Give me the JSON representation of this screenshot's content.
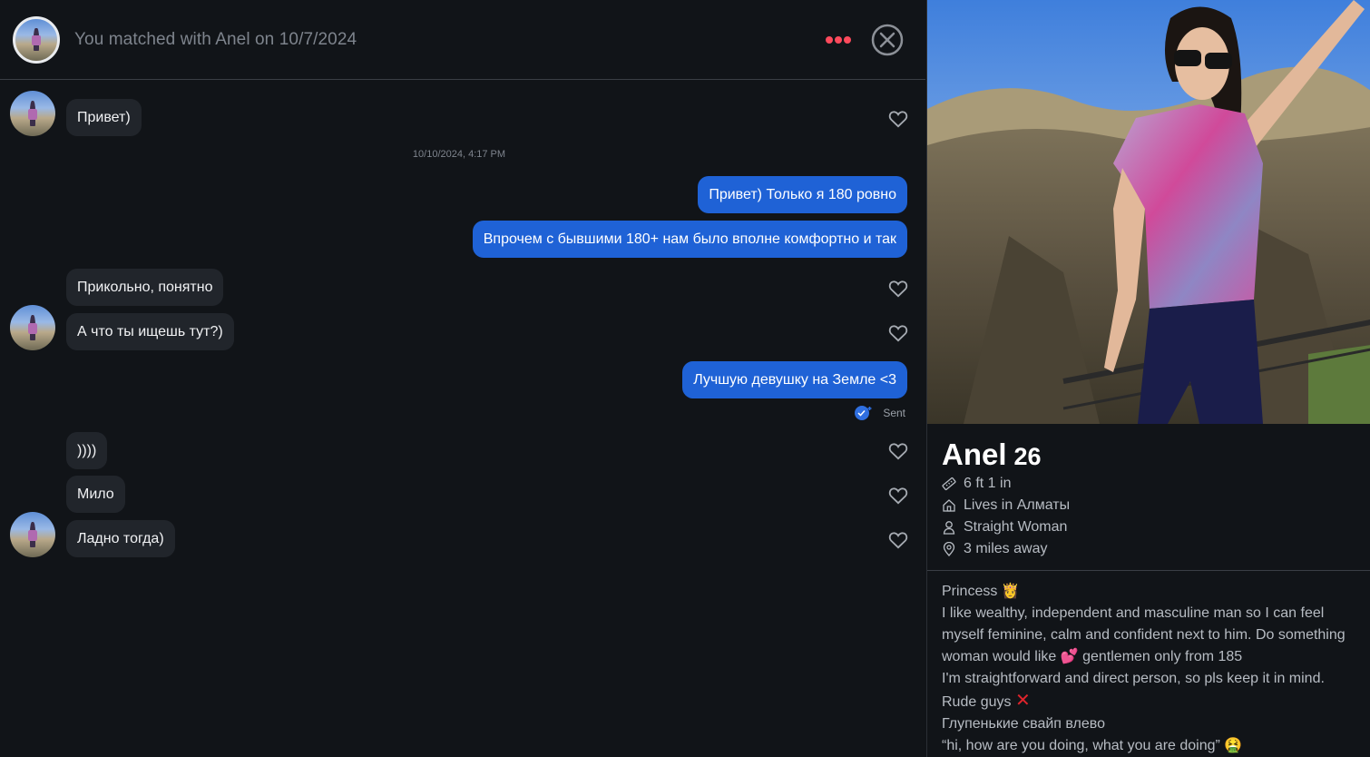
{
  "header": {
    "match_text": "You matched with Anel on 10/7/2024"
  },
  "messages": {
    "timestamp": "10/10/2024, 4:17 PM",
    "m1": "Привет)",
    "m2": "Привет) Только я 180 ровно",
    "m3": "Впрочем с бывшими 180+ нам было вполне комфортно и так",
    "m4": "Прикольно, понятно",
    "m5": "А что ты ищешь тут?)",
    "m6": "Лучшую девушку на Земле <3",
    "m7": "))))",
    "m8": "Мило",
    "m9": "Ладно тогда)",
    "sent_label": "Sent"
  },
  "profile": {
    "name": "Anel",
    "age": "26",
    "height": "6 ft 1 in",
    "lives": "Lives in Алматы",
    "orientation": "Straight Woman",
    "distance": "3 miles away",
    "bio": {
      "line1": "Princess 👸",
      "line2": "I like wealthy, independent and masculine man so I can feel",
      "line3": "myself feminine, calm and confident next to him. Do something",
      "line4": "woman would like 💕 gentlemen only from 185",
      "line5": "I'm straightforward and direct person, so pls keep it in mind.",
      "line6": "Rude guys",
      "line7": "Глупенькие свайп влево",
      "line8": "“hi, how are you doing, what you are doing” 🤮"
    }
  },
  "icons": {
    "more": "more-dots-icon",
    "close": "close-circle-icon",
    "heart": "heart-outline-icon",
    "ruler": "ruler-icon",
    "home": "home-icon",
    "person": "person-icon",
    "location": "location-pin-icon",
    "sent": "double-check-sent-icon"
  },
  "colors": {
    "accent_red": "#fd4a5c",
    "outgoing_bubble": "#1f62d6",
    "incoming_bubble": "#21252b",
    "background": "#111418"
  }
}
